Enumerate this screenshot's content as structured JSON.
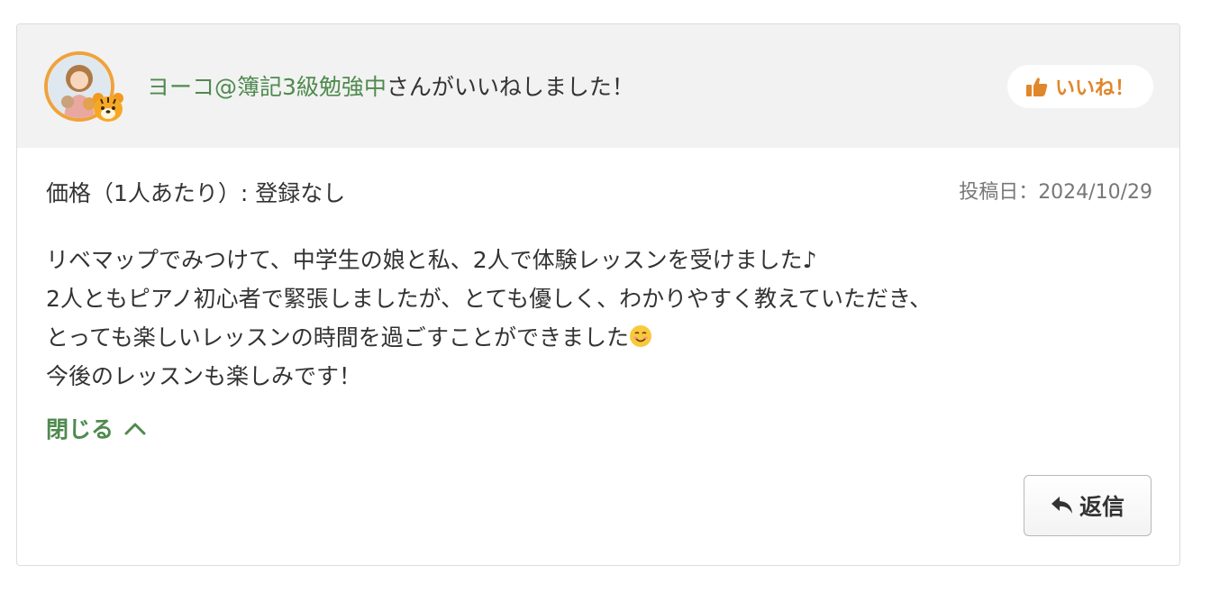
{
  "header": {
    "liker_name": "ヨーコ@簿記3級勉強中",
    "liker_suffix": "さんがいいねしました！",
    "like_button_label": "いいね！"
  },
  "review": {
    "price_text": "価格（1人あたり）: 登録なし",
    "post_date": "投稿日：2024/10/29",
    "lines": [
      "リベマップでみつけて、中学生の娘と私、2人で体験レッスンを受けました♪",
      "2人ともピアノ初心者で緊張しましたが、とても優しく、わかりやすく教えていただき、",
      "とっても楽しいレッスンの時間を過ごすことができました",
      "今後のレッスンも楽しみです！"
    ],
    "close_label": "閉じる",
    "reply_label": "返信"
  },
  "icons": {
    "avatar": "avatar-photo",
    "badge": "tiger-face-icon",
    "like": "thumbs-up-icon",
    "smile": "smiling-face-icon",
    "close": "chevron-up-icon",
    "reply": "reply-arrow-icon"
  },
  "colors": {
    "accent_orange": "#e0872b",
    "link_green": "#4f8a4f",
    "avatar_ring": "#f0a23c",
    "header_bg": "#f2f2f2"
  }
}
